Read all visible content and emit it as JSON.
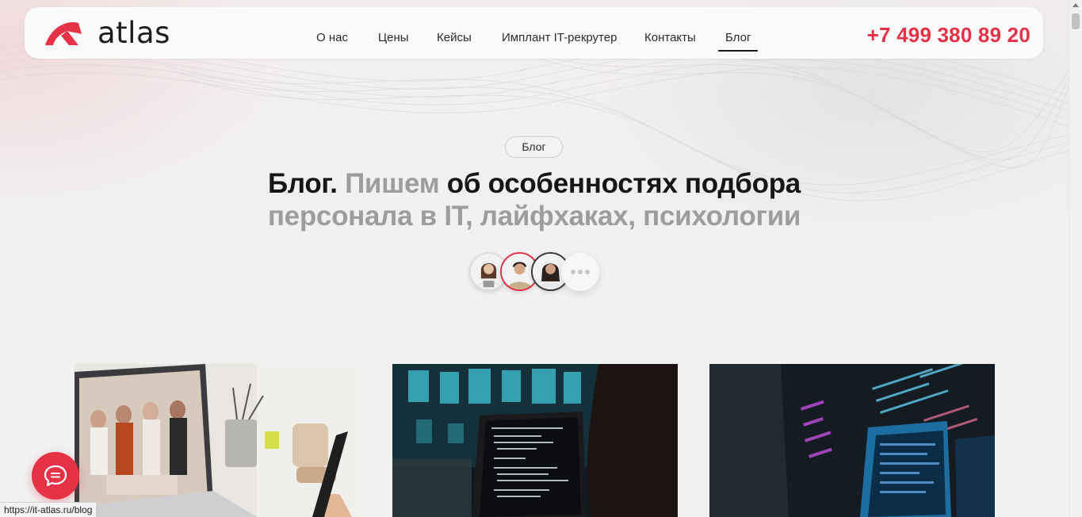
{
  "header": {
    "logo_text": "atlas",
    "phone": "+7 499 380 89 20",
    "nav": [
      {
        "label": "О нас"
      },
      {
        "label": "Цены"
      },
      {
        "label": "Кейсы"
      },
      {
        "label": "Имплант IT-рекрутер"
      },
      {
        "label": "Контакты"
      },
      {
        "label": "Блог",
        "active": true
      }
    ]
  },
  "hero": {
    "tag": "Блог",
    "title_part1": "Блог.",
    "title_part2": "Пишем",
    "title_part3": "об особенностях подбора",
    "title_line2": "персонала в IT, лайфхаках, психологии"
  },
  "status_url": "https://it-atlas.ru/blog",
  "colors": {
    "accent": "#e63246",
    "text": "#161616",
    "muted": "#9d9d9d"
  },
  "icons": {
    "chat": "chat-bubble-icon",
    "more": "more-dots-icon"
  }
}
